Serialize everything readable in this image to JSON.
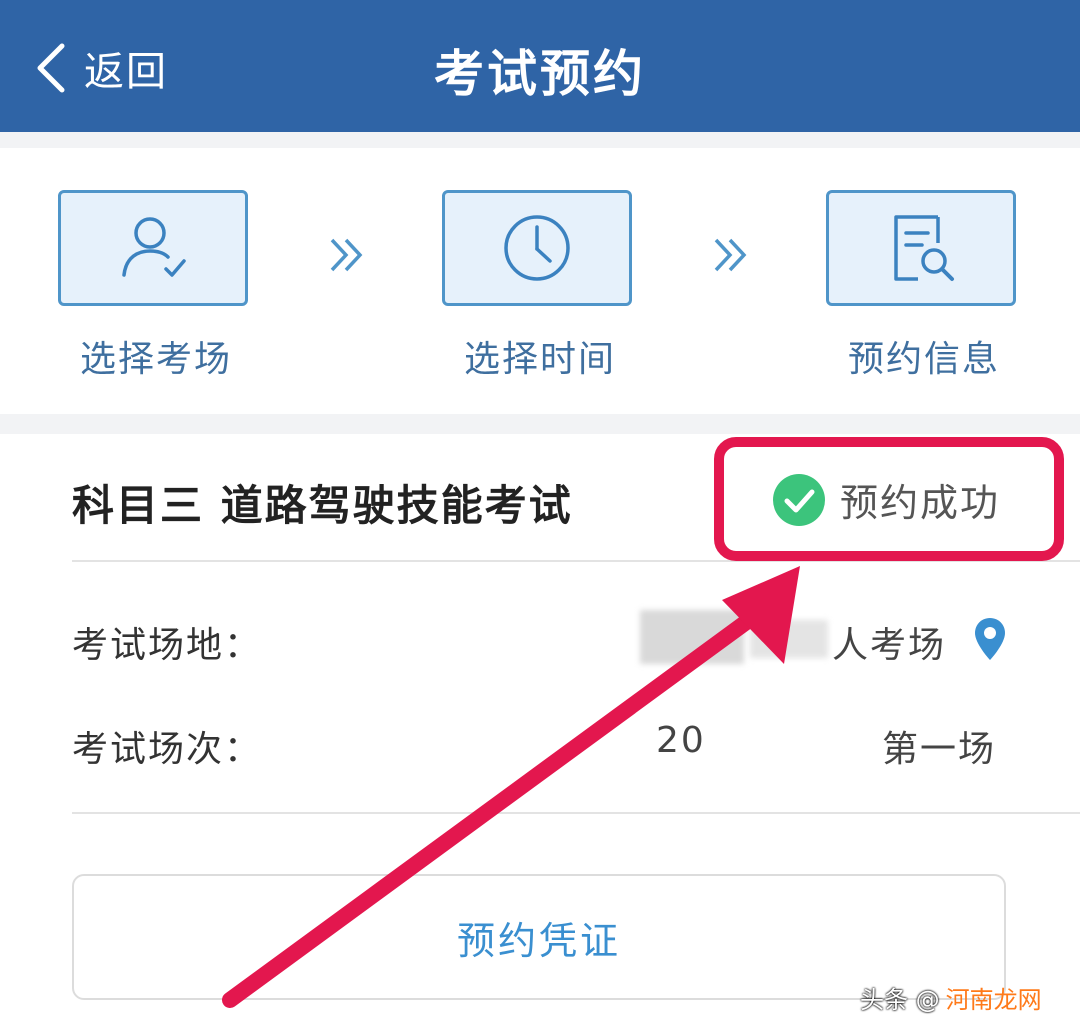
{
  "header": {
    "back_label": "返回",
    "title": "考试预约"
  },
  "steps": [
    {
      "label": "选择考场",
      "icon": "user-check-icon"
    },
    {
      "label": "选择时间",
      "icon": "clock-icon"
    },
    {
      "label": "预约信息",
      "icon": "document-search-icon"
    }
  ],
  "exam": {
    "name": "科目三 道路驾驶技能考试",
    "status": "预约成功",
    "venue_label": "考试场地：",
    "venue_value": "人考场",
    "session_label": "考试场次：",
    "session_date_partial": "20",
    "session_value": "第一场"
  },
  "voucher_button": "预约凭证",
  "watermark": {
    "prefix": "头条 @",
    "site": "河南龙网"
  },
  "colors": {
    "header_bg": "#2f64a6",
    "step_border": "#4f95c9",
    "success_green": "#3cc47c",
    "annotation_red": "#e3174e",
    "link_blue": "#3a8fd0"
  }
}
